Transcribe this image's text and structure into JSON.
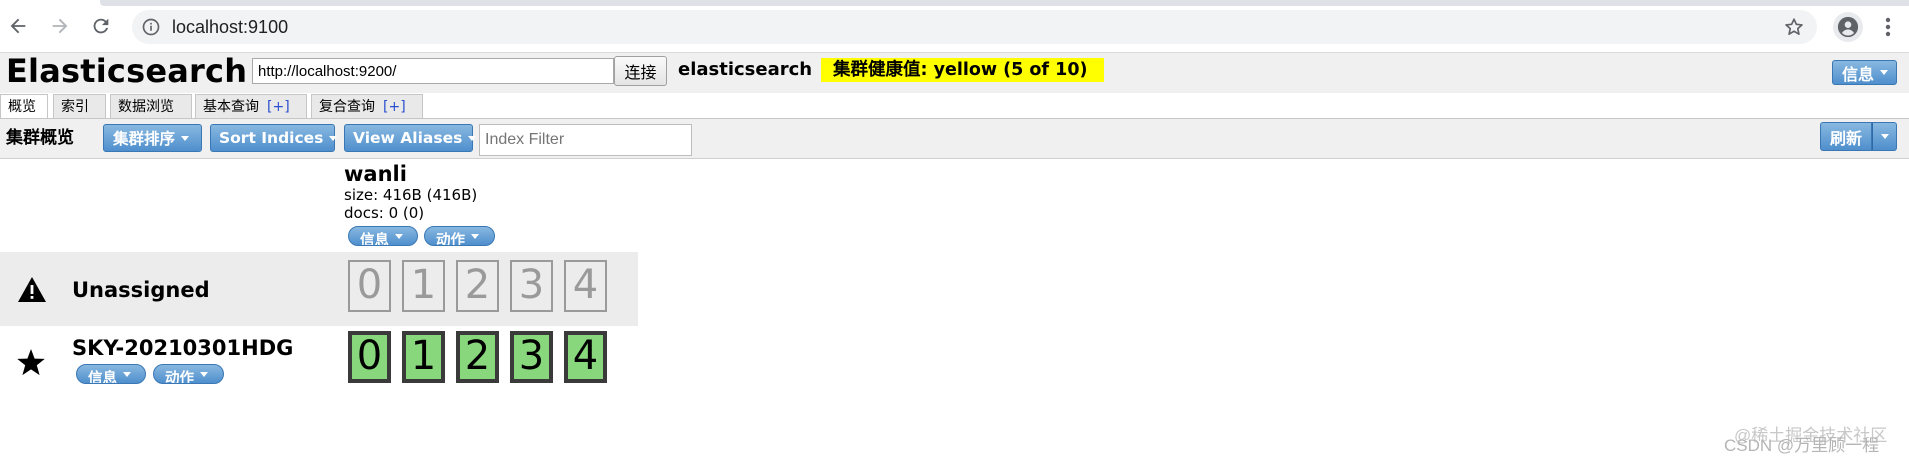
{
  "browser": {
    "url": "localhost:9100"
  },
  "header": {
    "title": "Elasticsearch",
    "connection_url": "http://localhost:9200/",
    "connect_label": "连接",
    "cluster_name": "elasticsearch",
    "health_label": "集群健康值: yellow (5 of 10)",
    "health_color": "#ffff00",
    "info_label": "信息"
  },
  "tabs": [
    {
      "label": "概览",
      "plus": ""
    },
    {
      "label": "索引",
      "plus": ""
    },
    {
      "label": "数据浏览",
      "plus": ""
    },
    {
      "label": "基本查询",
      "plus": "[+]"
    },
    {
      "label": "复合查询",
      "plus": "[+]"
    }
  ],
  "toolbar": {
    "title": "集群概览",
    "sort_cluster_label": "集群排序",
    "sort_indices_label": "Sort Indices",
    "view_aliases_label": "View Aliases",
    "index_filter_placeholder": "Index Filter",
    "refresh_label": "刷新"
  },
  "index": {
    "name": "wanli",
    "size": "size: 416B (416B)",
    "docs": "docs: 0 (0)",
    "info_label": "信息",
    "action_label": "动作"
  },
  "rows": {
    "unassigned": {
      "label": "Unassigned",
      "icon": "warning-icon",
      "shards": [
        "0",
        "1",
        "2",
        "3",
        "4"
      ]
    },
    "node": {
      "label": "SKY-20210301HDG",
      "icon": "star-icon",
      "info_label": "信息",
      "action_label": "动作",
      "shards": [
        "0",
        "1",
        "2",
        "3",
        "4"
      ]
    }
  },
  "colors": {
    "accent_blue": "#4f8fcd",
    "started_shard": "#88d77c",
    "unassigned_shard_border": "#9a9a9a"
  },
  "watermark": {
    "line1": "@稀土掘金技术社区",
    "line2": "CSDN @万里顾一程"
  }
}
